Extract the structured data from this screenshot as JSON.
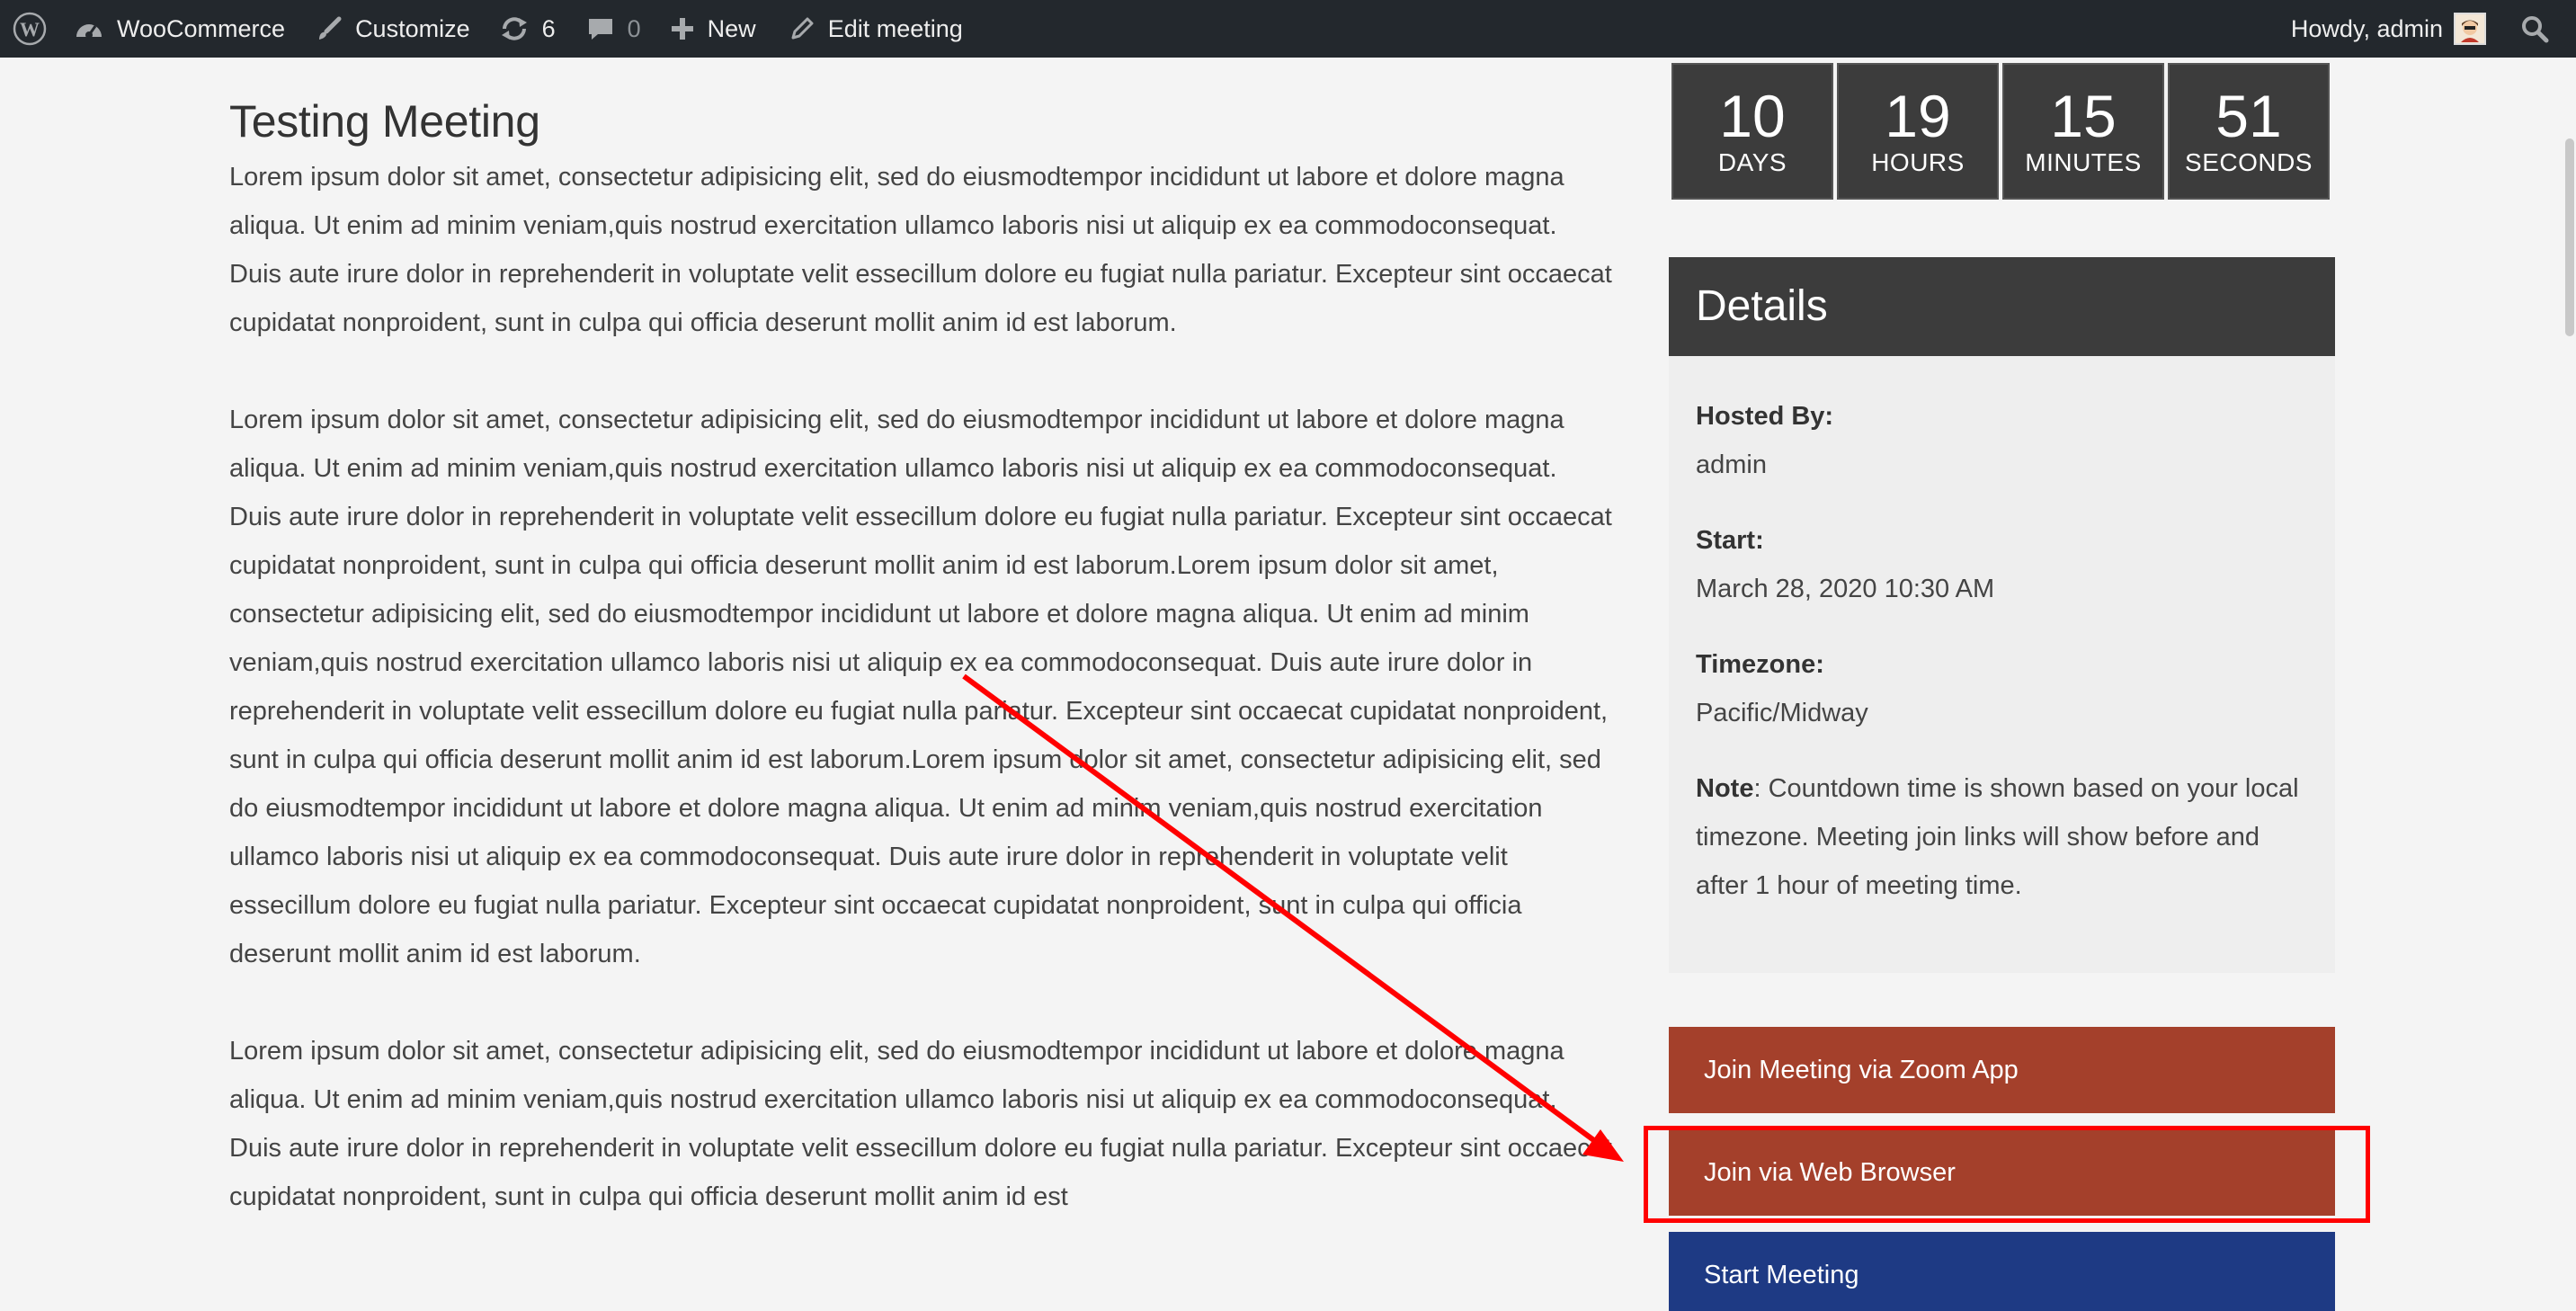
{
  "adminbar": {
    "site_name": "WooCommerce",
    "customize_label": "Customize",
    "updates_count": "6",
    "comments_count": "0",
    "new_label": "New",
    "edit_label": "Edit meeting",
    "howdy_label": "Howdy, admin"
  },
  "main": {
    "title": "Testing Meeting",
    "paragraphs": [
      "Lorem ipsum dolor sit amet, consectetur adipisicing elit, sed do eiusmodtempor incididunt ut labore et dolore magna aliqua. Ut enim ad minim veniam,quis nostrud exercitation ullamco laboris nisi ut aliquip ex ea commodoconsequat. Duis aute irure dolor in reprehenderit in voluptate velit essecillum dolore eu fugiat nulla pariatur. Excepteur sint occaecat cupidatat nonproident, sunt in culpa qui officia deserunt mollit anim id est laborum.",
      "Lorem ipsum dolor sit amet, consectetur adipisicing elit, sed do eiusmodtempor incididunt ut labore et dolore magna aliqua. Ut enim ad minim veniam,quis nostrud exercitation ullamco laboris nisi ut aliquip ex ea commodoconsequat. Duis aute irure dolor in reprehenderit in voluptate velit essecillum dolore eu fugiat nulla pariatur. Excepteur sint occaecat cupidatat nonproident, sunt in culpa qui officia deserunt mollit anim id est laborum.Lorem ipsum dolor sit amet, consectetur adipisicing elit, sed do eiusmodtempor incididunt ut labore et dolore magna aliqua. Ut enim ad minim veniam,quis nostrud exercitation ullamco laboris nisi ut aliquip ex ea commodoconsequat. Duis aute irure dolor in reprehenderit in voluptate velit essecillum dolore eu fugiat nulla pariatur. Excepteur sint occaecat cupidatat nonproident, sunt in culpa qui officia deserunt mollit anim id est laborum.Lorem ipsum dolor sit amet, consectetur adipisicing elit, sed do eiusmodtempor incididunt ut labore et dolore magna aliqua. Ut enim ad minim veniam,quis nostrud exercitation ullamco laboris nisi ut aliquip ex ea commodoconsequat. Duis aute irure dolor in reprehenderit in voluptate velit essecillum dolore eu fugiat nulla pariatur. Excepteur sint occaecat cupidatat nonproident, sunt in culpa qui officia deserunt mollit anim id est laborum.",
      "Lorem ipsum dolor sit amet, consectetur adipisicing elit, sed do eiusmodtempor incididunt ut labore et dolore magna aliqua. Ut enim ad minim veniam,quis nostrud exercitation ullamco laboris nisi ut aliquip ex ea commodoconsequat. Duis aute irure dolor in reprehenderit in voluptate velit essecillum dolore eu fugiat nulla pariatur. Excepteur sint occaecat cupidatat nonproident, sunt in culpa qui officia deserunt mollit anim id est"
    ]
  },
  "countdown": {
    "days": "10",
    "days_label": "DAYS",
    "hours": "19",
    "hours_label": "HOURS",
    "minutes": "15",
    "minutes_label": "MINUTES",
    "seconds": "51",
    "seconds_label": "SECONDS"
  },
  "details": {
    "heading": "Details",
    "hosted_by_label": "Hosted By:",
    "hosted_by_value": "admin",
    "start_label": "Start:",
    "start_value": "March 28, 2020 10:30 AM",
    "timezone_label": "Timezone:",
    "timezone_value": "Pacific/Midway",
    "note_label": "Note",
    "note_text": ": Countdown time is shown based on your local timezone. Meeting join links will show before and after 1 hour of meeting time."
  },
  "buttons": {
    "zoom_app": "Join Meeting via Zoom App",
    "web_browser": "Join via Web Browser",
    "start_meeting": "Start Meeting"
  },
  "colors": {
    "adminbar_bg": "#23282d",
    "join_button": "#a4402b",
    "start_button": "#1e3a84",
    "annotation": "#ff0000"
  }
}
